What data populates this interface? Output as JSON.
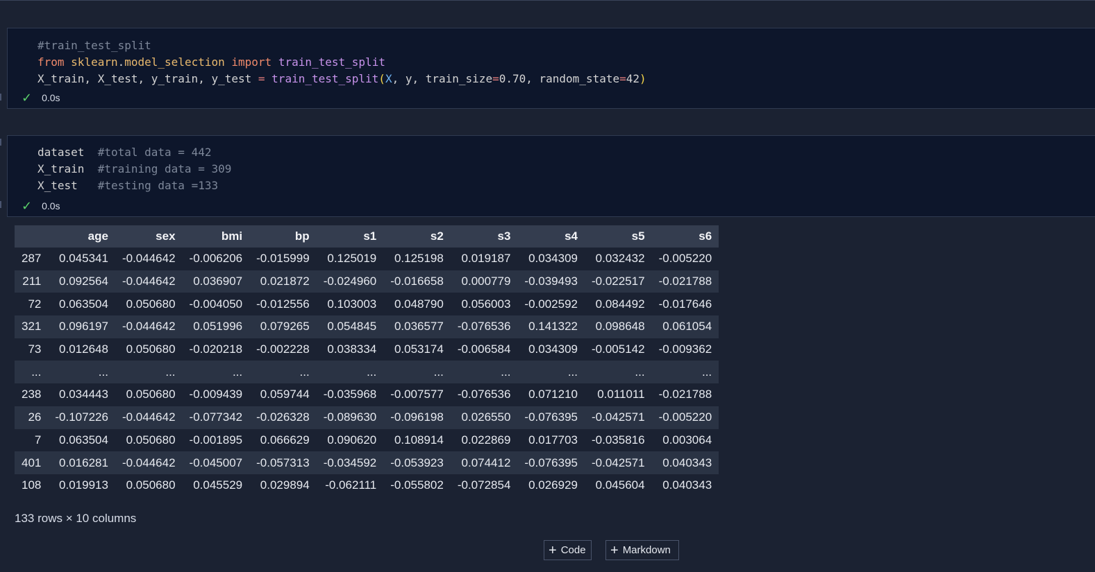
{
  "cells": [
    {
      "code_lines": [
        [
          {
            "t": "#train_test_split",
            "c": "cm"
          }
        ],
        [
          {
            "t": "from",
            "c": "kw"
          },
          {
            "t": " ",
            "c": ""
          },
          {
            "t": "sklearn",
            "c": "mod"
          },
          {
            "t": ".",
            "c": ""
          },
          {
            "t": "model_selection",
            "c": "mod"
          },
          {
            "t": " ",
            "c": ""
          },
          {
            "t": "import",
            "c": "kw"
          },
          {
            "t": " ",
            "c": ""
          },
          {
            "t": "train_test_split",
            "c": "fn"
          }
        ],
        [
          {
            "t": "X_train, X_test, y_train, y_test ",
            "c": ""
          },
          {
            "t": "=",
            "c": "op"
          },
          {
            "t": " ",
            "c": ""
          },
          {
            "t": "train_test_split",
            "c": "fn"
          },
          {
            "t": "(",
            "c": "par"
          },
          {
            "t": "X",
            "c": "var-x"
          },
          {
            "t": ", y, train_size",
            "c": ""
          },
          {
            "t": "=",
            "c": "op"
          },
          {
            "t": "0.70, random_state",
            "c": ""
          },
          {
            "t": "=",
            "c": "op"
          },
          {
            "t": "42",
            "c": ""
          },
          {
            "t": ")",
            "c": "par"
          }
        ]
      ],
      "exec_time": "0.0s"
    },
    {
      "code_lines": [
        [
          {
            "t": "dataset  ",
            "c": ""
          },
          {
            "t": "#total data = 442",
            "c": "cm"
          }
        ],
        [
          {
            "t": "X_train  ",
            "c": ""
          },
          {
            "t": "#training data = 309",
            "c": "cm"
          }
        ],
        [
          {
            "t": "X_test   ",
            "c": ""
          },
          {
            "t": "#testing data =133",
            "c": "cm"
          }
        ]
      ],
      "exec_time": "0.0s"
    }
  ],
  "dataframe": {
    "columns": [
      "",
      "age",
      "sex",
      "bmi",
      "bp",
      "s1",
      "s2",
      "s3",
      "s4",
      "s5",
      "s6"
    ],
    "rows": [
      [
        "287",
        "0.045341",
        "-0.044642",
        "-0.006206",
        "-0.015999",
        "0.125019",
        "0.125198",
        "0.019187",
        "0.034309",
        "0.032432",
        "-0.005220"
      ],
      [
        "211",
        "0.092564",
        "-0.044642",
        "0.036907",
        "0.021872",
        "-0.024960",
        "-0.016658",
        "0.000779",
        "-0.039493",
        "-0.022517",
        "-0.021788"
      ],
      [
        "72",
        "0.063504",
        "0.050680",
        "-0.004050",
        "-0.012556",
        "0.103003",
        "0.048790",
        "0.056003",
        "-0.002592",
        "0.084492",
        "-0.017646"
      ],
      [
        "321",
        "0.096197",
        "-0.044642",
        "0.051996",
        "0.079265",
        "0.054845",
        "0.036577",
        "-0.076536",
        "0.141322",
        "0.098648",
        "0.061054"
      ],
      [
        "73",
        "0.012648",
        "0.050680",
        "-0.020218",
        "-0.002228",
        "0.038334",
        "0.053174",
        "-0.006584",
        "0.034309",
        "-0.005142",
        "-0.009362"
      ],
      [
        "...",
        "...",
        "...",
        "...",
        "...",
        "...",
        "...",
        "...",
        "...",
        "...",
        "..."
      ],
      [
        "238",
        "0.034443",
        "0.050680",
        "-0.009439",
        "0.059744",
        "-0.035968",
        "-0.007577",
        "-0.076536",
        "0.071210",
        "0.011011",
        "-0.021788"
      ],
      [
        "26",
        "-0.107226",
        "-0.044642",
        "-0.077342",
        "-0.026328",
        "-0.089630",
        "-0.096198",
        "0.026550",
        "-0.076395",
        "-0.042571",
        "-0.005220"
      ],
      [
        "7",
        "0.063504",
        "0.050680",
        "-0.001895",
        "0.066629",
        "0.090620",
        "0.108914",
        "0.022869",
        "0.017703",
        "-0.035816",
        "0.003064"
      ],
      [
        "401",
        "0.016281",
        "-0.044642",
        "-0.045007",
        "-0.057313",
        "-0.034592",
        "-0.053923",
        "0.074412",
        "-0.076395",
        "-0.042571",
        "0.040343"
      ],
      [
        "108",
        "0.019913",
        "0.050680",
        "0.045529",
        "0.029894",
        "-0.062111",
        "-0.055802",
        "-0.072854",
        "0.026929",
        "0.045604",
        "0.040343"
      ]
    ],
    "shape_text": "133 rows × 10 columns"
  },
  "toolbar": {
    "add_code_label": "Code",
    "add_markdown_label": "Markdown",
    "plus_icon": "plus-icon"
  },
  "colors": {
    "success": "#5bd16a",
    "cell_bg": "#0d162b",
    "page_bg": "#1b2232"
  }
}
